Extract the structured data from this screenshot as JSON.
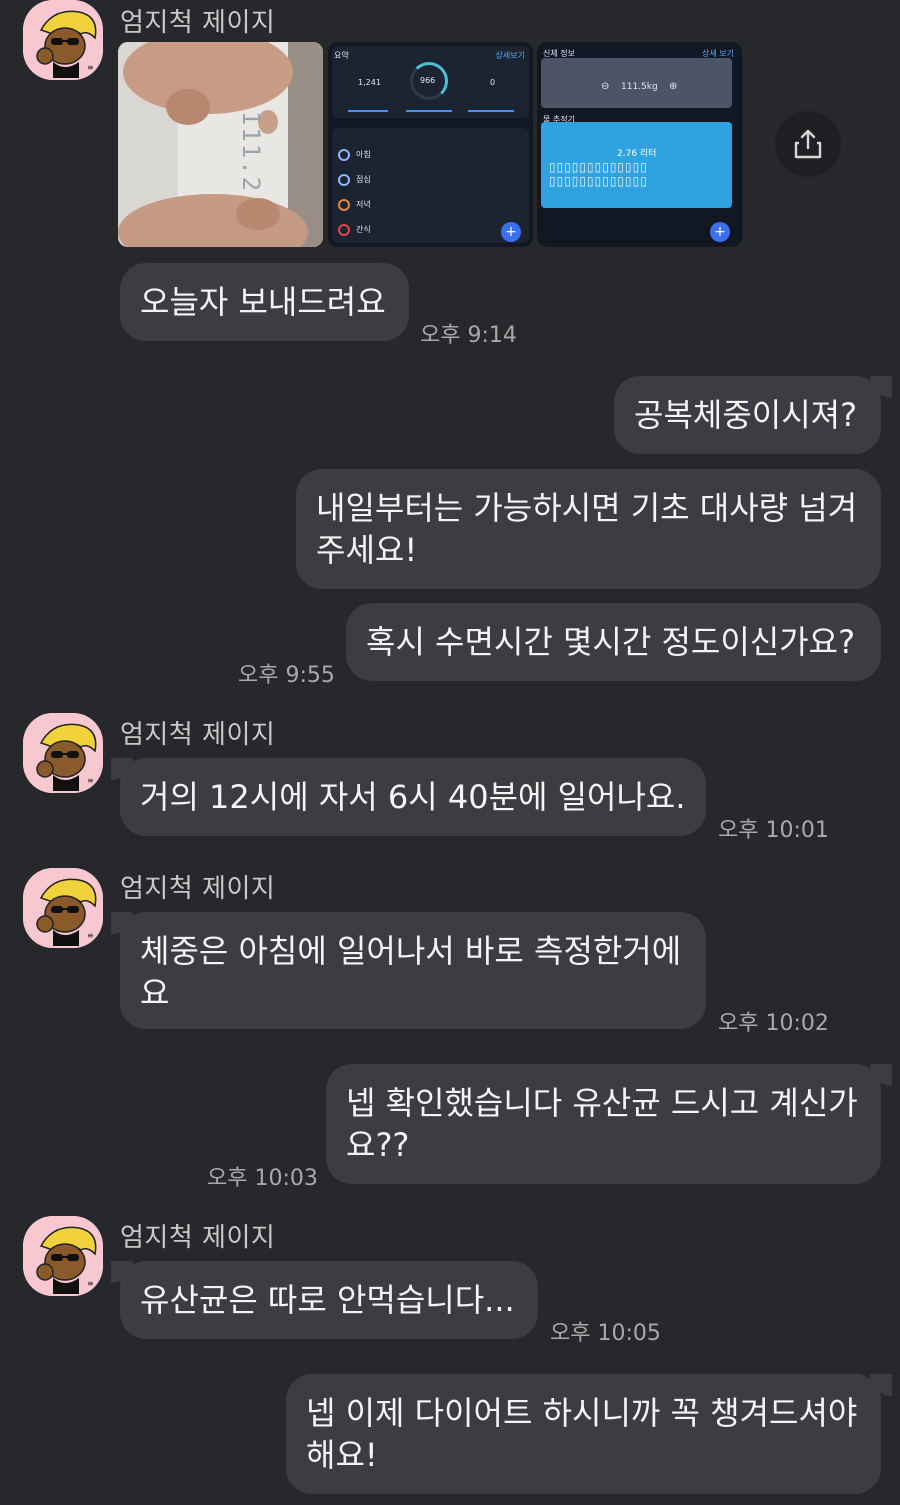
{
  "sender_name": "엄지척 제이지",
  "messages": [
    {
      "text": "오늘자 보내드려요",
      "time": "오후 9:14"
    },
    {
      "text": "공복체중이시져?"
    },
    {
      "text": "내일부터는 가능하시면 기초 대사량 넘겨 주세요!"
    },
    {
      "text": "혹시 수면시간 몇시간 정도이신가요?",
      "time": "오후 9:55"
    },
    {
      "text": "거의 12시에 자서 6시 40분에 일어나요.",
      "time": "오후 10:01"
    },
    {
      "text": "체중은 아침에 일어나서 바로 측정한거에요",
      "time": "오후 10:02"
    },
    {
      "text": "넵 확인했습니다 유산균 드시고 계신가요??",
      "time": "오후 10:03"
    },
    {
      "text": "유산균은 따로 안먹습니다...",
      "time": "오후 10:05"
    },
    {
      "text": "넵 이제 다이어트 하시니까 꼭 챙겨드셔야 해요!"
    }
  ],
  "photos": {
    "scale_display": "111.2",
    "app1": {
      "header_left": "요약",
      "header_right": "상세보기",
      "eaten": "1,241",
      "remaining": "966",
      "burned": "0",
      "meals": [
        "아침",
        "점심",
        "저녁",
        "간식"
      ]
    },
    "app2": {
      "header_left": "신체 정보",
      "header_right": "상세 보기",
      "weight": "111.5kg",
      "water_label": "물 추적기",
      "water_amount": "2.76 리터"
    }
  },
  "icons": {
    "share": "share-icon",
    "avatar": "avatar-character-icon"
  }
}
